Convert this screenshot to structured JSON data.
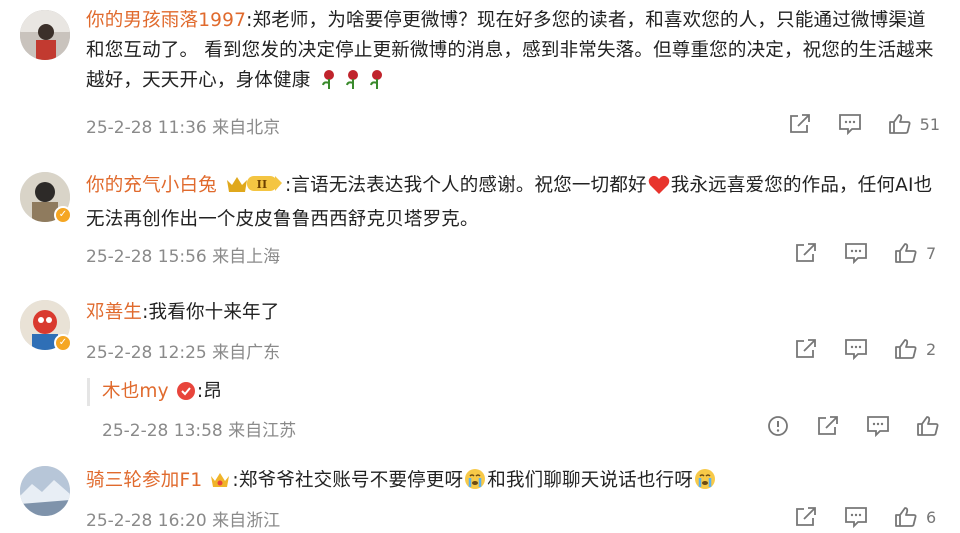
{
  "comments": [
    {
      "username": "你的男孩雨落1997",
      "body": ":郑老师，为啥要停更微博？现在好多您的读者，和喜欢您的人，只能通过微博渠道和您互动了。 看到您发的决定停止更新微博的消息，感到非常失落。但尊重您的决定，祝您的生活越来越好，天天开心，身体健康",
      "emoji_trailing": [
        "rose-emoji",
        "rose-emoji",
        "rose-emoji"
      ],
      "time": "25-2-28 11:36",
      "location": "来自北京",
      "likes": "51"
    },
    {
      "username": "你的充气小白兔",
      "badge": "II",
      "body_1": ":言语无法表达我个人的感谢。祝您一切都好",
      "body_2": "我永远喜爱您的作品，任何AI也无法再创作出一个皮皮鲁鲁西西舒克贝塔罗克。",
      "time": "25-2-28 15:56",
      "location": "来自上海",
      "likes": "7"
    },
    {
      "username": "邓善生",
      "body": ":我看你十来年了",
      "time": "25-2-28 12:25",
      "location": "来自广东",
      "likes": "2",
      "reply": {
        "username": "木也my",
        "body": ":昂",
        "time": "25-2-28 13:58",
        "location": "来自江苏"
      }
    },
    {
      "username": "骑三轮参加F1",
      "body_1": ":郑爷爷社交账号不要停更呀",
      "body_2": "和我们聊聊天说话也行呀",
      "time": "25-2-28 16:20",
      "location": "来自浙江",
      "likes": "6"
    }
  ],
  "colors": {
    "username": "#e06a2d",
    "meta": "#8a8a8a",
    "icon": "#777777",
    "vip": "#f5a623"
  },
  "icons": [
    "share-icon",
    "comment-icon",
    "like-icon",
    "report-icon",
    "rose-emoji",
    "heart-emoji",
    "crying-emoji",
    "crown-badge-icon"
  ]
}
